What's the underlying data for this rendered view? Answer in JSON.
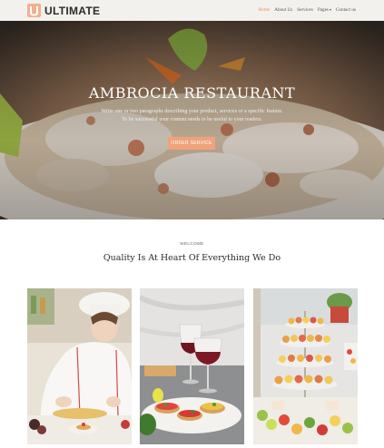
{
  "brand": {
    "name": "ULTIMATE",
    "accent": "#f08a5d"
  },
  "nav": {
    "items": [
      {
        "label": "Home",
        "active": true
      },
      {
        "label": "About Us",
        "active": false
      },
      {
        "label": "Services",
        "active": false
      },
      {
        "label": "Pages",
        "active": false,
        "dropdown": true
      },
      {
        "label": "Contact us",
        "active": false
      }
    ]
  },
  "hero": {
    "title": "AMBROCIA RESTAURANT",
    "subtitle_line1": "Write one or two paragraphs describing your product, services or a specific feature.",
    "subtitle_line2": "To be successful your content needs to be useful to your readers.",
    "button_label": "ORDER SERVICE"
  },
  "section": {
    "eyebrow": "WELCOME",
    "heading": "Quality Is At Heart Of Everything We Do"
  },
  "cards": [
    {
      "image": "chef-decorating-tarts-photo"
    },
    {
      "image": "wine-glasses-and-bruschetta-photo"
    },
    {
      "image": "dessert-buffet-photo"
    }
  ]
}
